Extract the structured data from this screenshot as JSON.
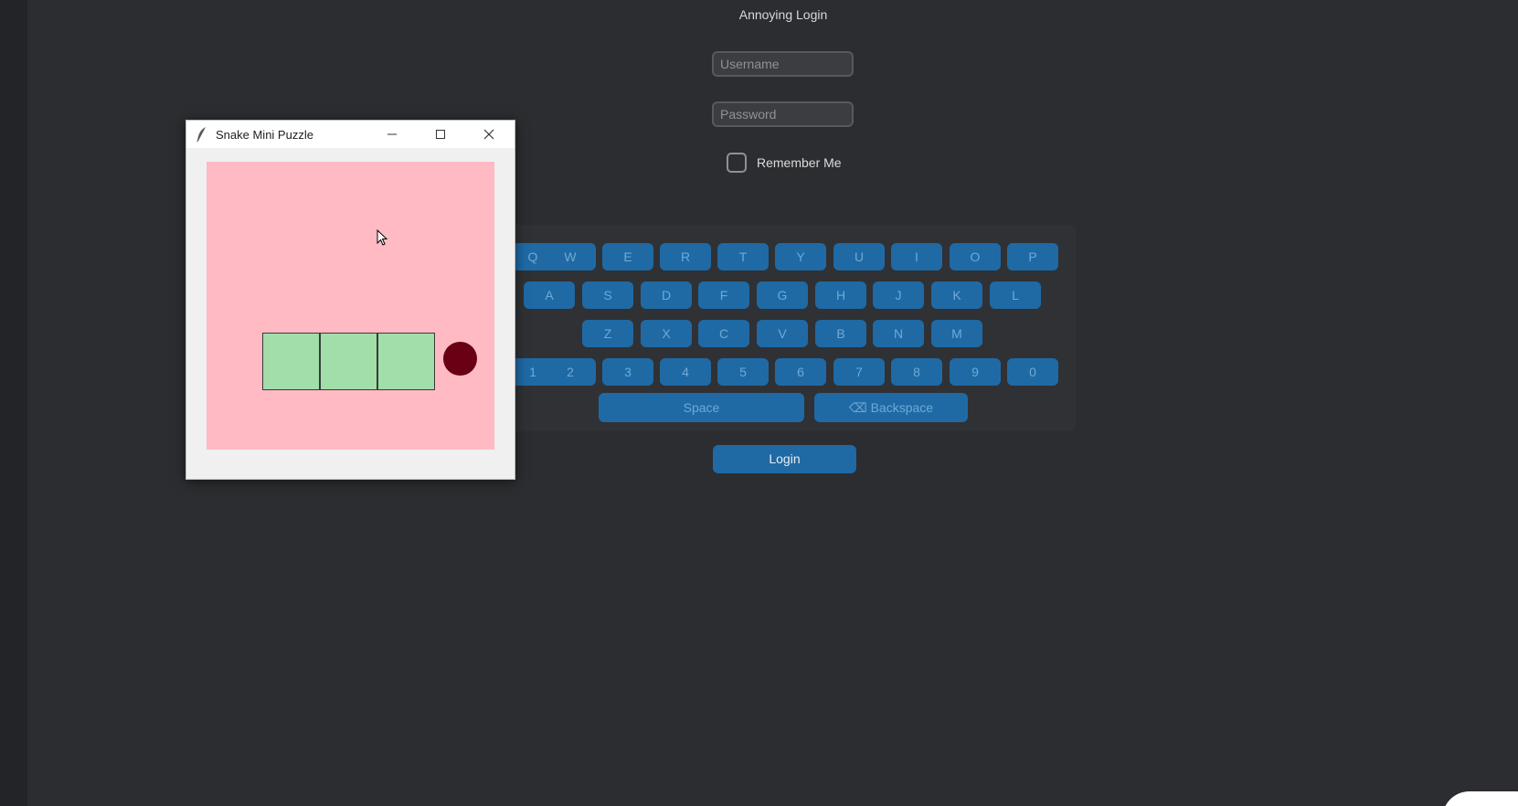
{
  "app": {
    "title": "Annoying Login"
  },
  "form": {
    "username_placeholder": "Username",
    "password_placeholder": "Password",
    "remember_label": "Remember Me",
    "remember_checked": false,
    "login_label": "Login"
  },
  "keyboard": {
    "row1": [
      "Q",
      "W",
      "E",
      "R",
      "T",
      "Y",
      "U",
      "I",
      "O",
      "P"
    ],
    "row2": [
      "A",
      "S",
      "D",
      "F",
      "G",
      "H",
      "J",
      "K",
      "L"
    ],
    "row3": [
      "Z",
      "X",
      "C",
      "V",
      "B",
      "N",
      "M"
    ],
    "row4": [
      "1",
      "2",
      "3",
      "4",
      "5",
      "6",
      "7",
      "8",
      "9",
      "0"
    ],
    "space_label": "Space",
    "backspace_label": "⌫ Backspace"
  },
  "popup": {
    "title": "Snake Mini Puzzle",
    "icon": "feather-icon",
    "controls": [
      "minimize-icon",
      "maximize-icon",
      "close-icon"
    ],
    "canvas_color": "#ffbac4",
    "snake_color": "#a1dea9",
    "food_color": "#6a0014"
  },
  "colors": {
    "background": "#2b2d30",
    "accent": "#1f6aa5"
  }
}
